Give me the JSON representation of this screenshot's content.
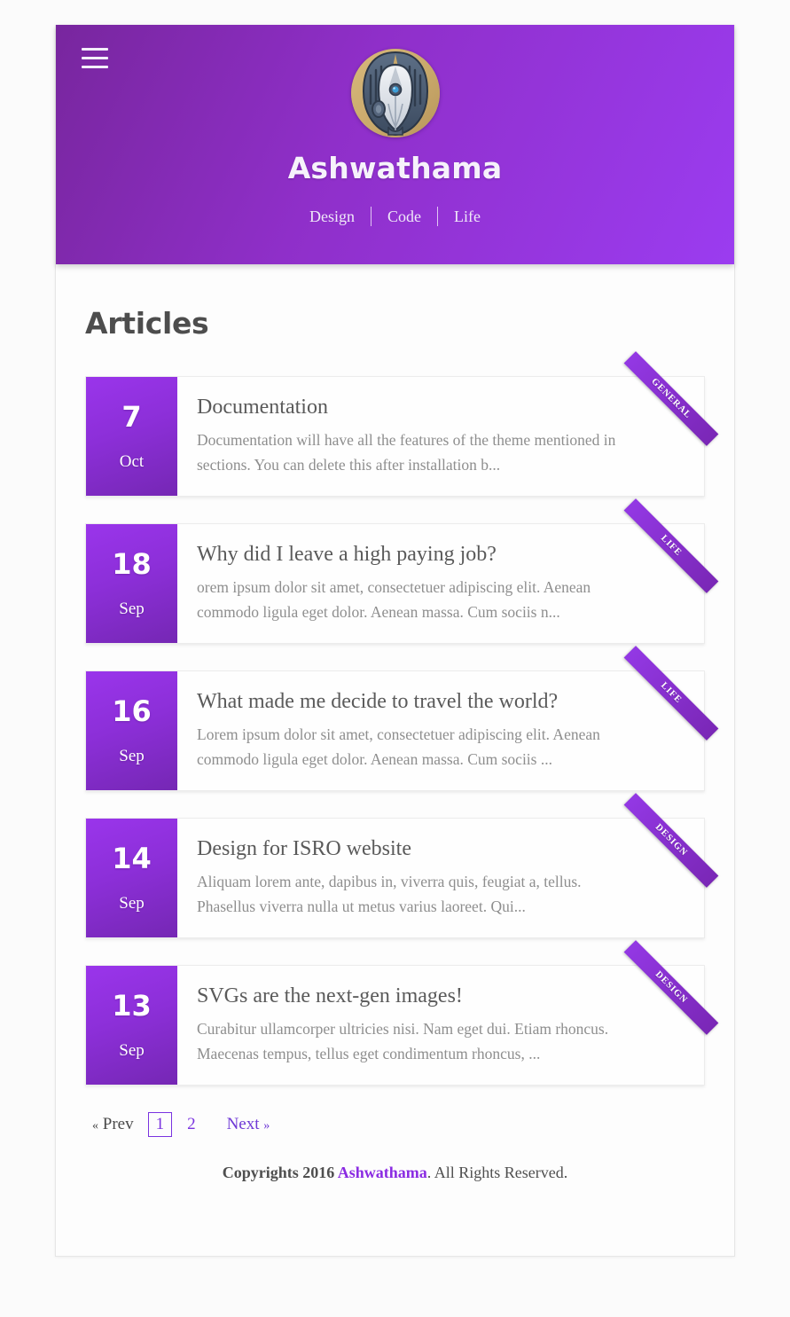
{
  "header": {
    "menu_icon": "hamburger-menu-icon",
    "avatar_alt": "site-avatar",
    "site_title": "Ashwathama",
    "nav": [
      {
        "label": "Design"
      },
      {
        "label": "Code"
      },
      {
        "label": "Life"
      }
    ]
  },
  "main": {
    "page_heading": "Articles",
    "articles": [
      {
        "day": "7",
        "month": "Oct",
        "title": "Documentation",
        "excerpt": "Documentation will have all the features of the theme mentioned in sections. You can delete this after installation b...",
        "tag": "GENERAL"
      },
      {
        "day": "18",
        "month": "Sep",
        "title": "Why did I leave a high paying job?",
        "excerpt": "orem ipsum dolor sit amet, consectetuer adipiscing elit. Aenean commodo ligula eget dolor. Aenean massa. Cum sociis n...",
        "tag": "LIFE"
      },
      {
        "day": "16",
        "month": "Sep",
        "title": "What made me decide to travel the world?",
        "excerpt": "Lorem ipsum dolor sit amet, consectetuer adipiscing elit. Aenean commodo ligula eget dolor. Aenean massa. Cum sociis ...",
        "tag": "LIFE"
      },
      {
        "day": "14",
        "month": "Sep",
        "title": "Design for ISRO website",
        "excerpt": "Aliquam lorem ante, dapibus in, viverra quis, feugiat a, tellus. Phasellus viverra nulla ut metus varius laoreet. Qui...",
        "tag": "DESIGN"
      },
      {
        "day": "13",
        "month": "Sep",
        "title": "SVGs are the next-gen images!",
        "excerpt": "Curabitur ullamcorper ultricies nisi. Nam eget dui. Etiam rhoncus. Maecenas tempus, tellus eget condimentum rhoncus, ...",
        "tag": "DESIGN"
      }
    ]
  },
  "pagination": {
    "prev_label": "Prev",
    "prev_chevron": "«",
    "pages": [
      {
        "label": "1",
        "current": true
      },
      {
        "label": "2",
        "current": false
      }
    ],
    "next_label": "Next",
    "next_chevron": "»"
  },
  "footer": {
    "copyright_prefix": "Copyrights 2016 ",
    "brand": "Ashwathama",
    "copyright_suffix": ". All Rights Reserved."
  },
  "colors": {
    "header_gradient_start": "#78269e",
    "header_gradient_end": "#9b3cf0",
    "accent_purple": "#8a2be2",
    "date_gradient_start": "#9a35eb",
    "date_gradient_end": "#7527b4",
    "heading_gray": "#4d4d4d",
    "title_gray": "#5a5a5a",
    "excerpt_gray": "#8e8e8e",
    "page_background": "#fbfbfb",
    "avatar_background": "#c9a96b"
  }
}
